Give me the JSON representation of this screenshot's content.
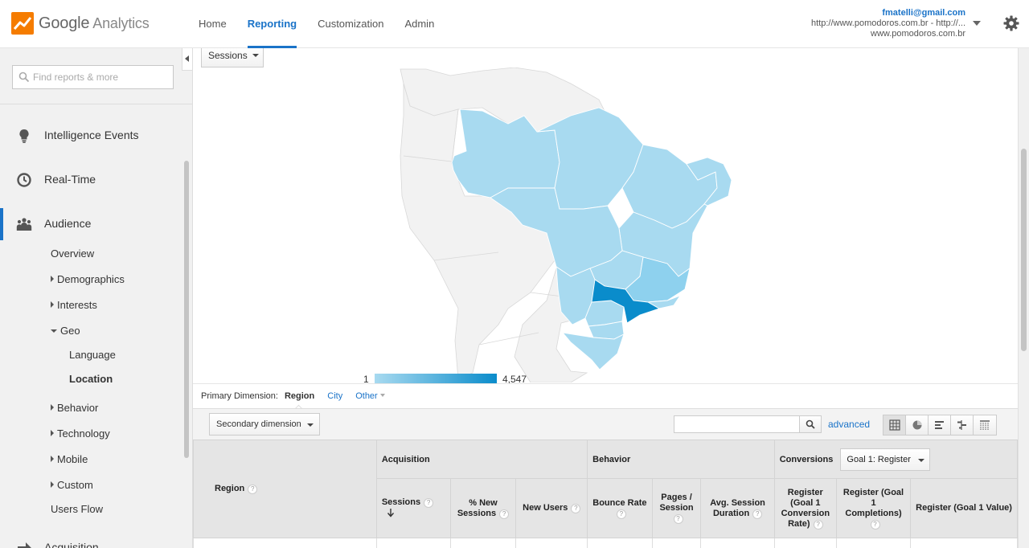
{
  "app": {
    "logo_brand": "Google",
    "logo_product": "Analytics",
    "nav": [
      "Home",
      "Reporting",
      "Customization",
      "Admin"
    ],
    "nav_active": "Reporting",
    "account_email": "fmatelli@gmail.com",
    "account_property": "http://www.pomodoros.com.br - http://...",
    "account_view": "www.pomodoros.com.br"
  },
  "sidebar": {
    "search_placeholder": "Find reports & more",
    "main_items": [
      {
        "label": "Intelligence Events",
        "icon": "lightbulb-icon"
      },
      {
        "label": "Real-Time",
        "icon": "clock-icon"
      },
      {
        "label": "Audience",
        "icon": "people-icon"
      },
      {
        "label": "Acquisition",
        "icon": "arrow-right-icon"
      }
    ],
    "audience_items": {
      "overview": "Overview",
      "demographics": "Demographics",
      "interests": "Interests",
      "geo": "Geo",
      "language": "Language",
      "location": "Location",
      "behavior": "Behavior",
      "technology": "Technology",
      "mobile": "Mobile",
      "custom": "Custom",
      "users_flow": "Users Flow"
    }
  },
  "map": {
    "metric_selector": "Sessions",
    "legend_min": "1",
    "legend_max": "4,547",
    "colors": {
      "low": "#a8daf0",
      "mid": "#8ed1ee",
      "high": "#0a8ccb",
      "none": "#f2f2f2"
    }
  },
  "dimensions": {
    "label": "Primary Dimension:",
    "active": "Region",
    "links": [
      "City",
      "Other"
    ]
  },
  "toolbar": {
    "secondary_dimension": "Secondary dimension",
    "advanced": "advanced",
    "view_icons": [
      "table-view-icon",
      "pie-view-icon",
      "bar-view-icon",
      "comparison-view-icon",
      "pivot-view-icon"
    ]
  },
  "table": {
    "region_header": "Region",
    "groups": {
      "acquisition": "Acquisition",
      "behavior": "Behavior",
      "conversions": "Conversions",
      "goal_selector": "Goal 1: Register"
    },
    "columns": {
      "sessions": "Sessions",
      "pct_new_sessions": "% New Sessions",
      "new_users": "New Users",
      "bounce_rate": "Bounce Rate",
      "pages_session": "Pages / Session",
      "avg_session_duration": "Avg. Session Duration",
      "conv_rate": "Register (Goal 1 Conversion Rate)",
      "completions": "Register (Goal 1 Completions)",
      "value": "Register (Goal 1 Value)"
    }
  }
}
